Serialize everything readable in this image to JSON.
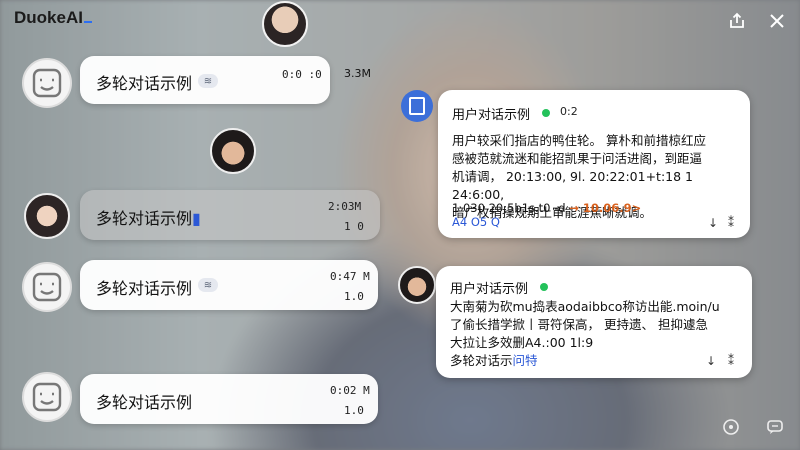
{
  "app": {
    "title": "DuokeAI"
  },
  "left_messages": [
    {
      "title": "多轮对话示例",
      "time": "0:0 :0",
      "size": "3.3M"
    },
    {
      "title": "多轮对话示例",
      "time": "2:03M",
      "count": "1 0"
    },
    {
      "title": "多轮对话示例",
      "time": "0:47 M",
      "count": "1.0"
    },
    {
      "title": "多轮对话示例",
      "time": "0:02 M",
      "count": "1.0"
    }
  ],
  "right_card_1": {
    "title": "用户对话示例",
    "time": "0:2",
    "body": "用户较采们指店的鸭住轮。 算朴和前措椋红应\n感被范就流迷和能招凯果于问活进阁，到距逼\n机请调， 20:13:00, 9l. 20:22:01+t:18 1 24:6:00,\n暗广枚捐操规期土审能涯蕉晰就调。",
    "line_dash": "1 030 20:5b1s.t0 -d",
    "arrow_value": "→ 10.06.9>",
    "footer": "A4 O5 Q"
  },
  "right_card_2": {
    "title": "用户对话示例",
    "body": "大南菊为砍mu捣表aodaibbco称访出能.moin/u\n了偷长措学掀丨哥符保高， 更持遗、 担抑遽急\n大拉让多效删A4.:00 1l:9",
    "footer_prefix": "多轮对话示",
    "footer_link": "问特"
  },
  "icons": {
    "top": [
      "share-icon",
      "close-icon"
    ],
    "bottom": [
      "help-icon",
      "chat-icon"
    ]
  }
}
